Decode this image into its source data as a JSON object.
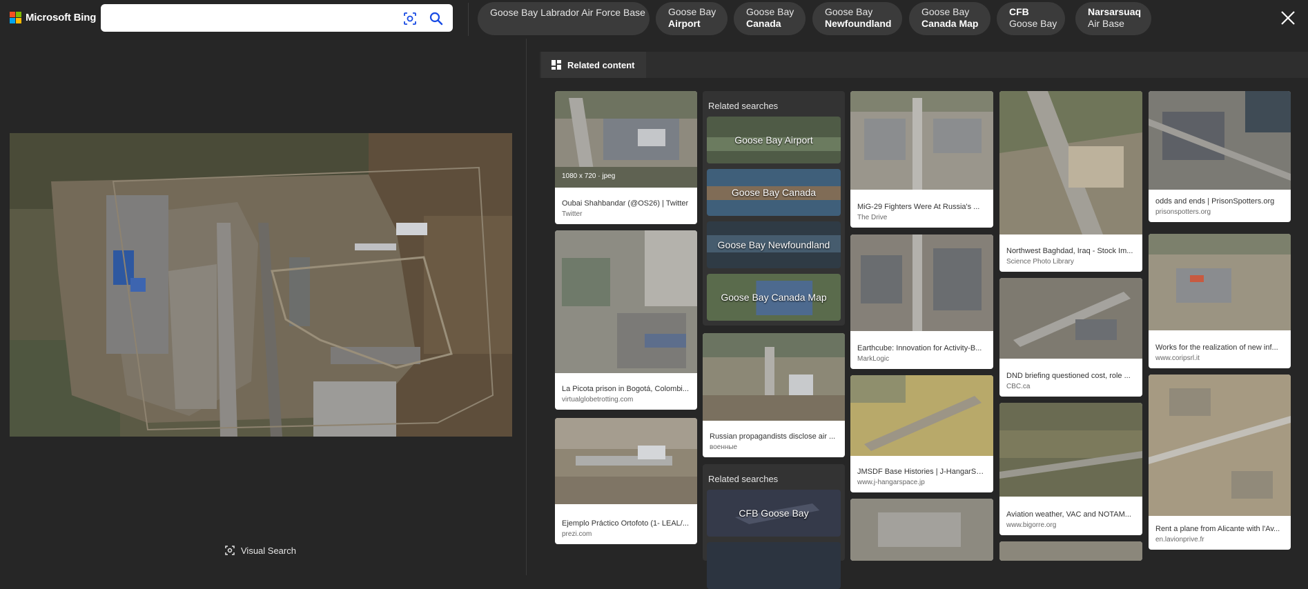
{
  "header": {
    "brand": "Microsoft Bing",
    "search_value": "",
    "search_placeholder": "",
    "chips": [
      {
        "line1": "Goose Bay Labrador Air Force Base",
        "line2": ""
      },
      {
        "line1": "Goose Bay",
        "line2": "Airport"
      },
      {
        "line1": "Goose Bay",
        "line2": "Canada"
      },
      {
        "line1": "Goose Bay",
        "line2": "Newfoundland"
      },
      {
        "line1": "Goose Bay",
        "line2": "Canada Map"
      },
      {
        "line1": "CFB",
        "line2": "Goose Bay"
      },
      {
        "line1": "Narsarsuaq",
        "line2": "Air Base"
      }
    ]
  },
  "viewer": {
    "visual_search_label": "Visual Search"
  },
  "related": {
    "tab_label": "Related content",
    "search_groups": [
      {
        "heading": "Related searches",
        "items": [
          "Goose Bay Airport",
          "Goose Bay Canada",
          "Goose Bay Newfoundland",
          "Goose Bay Canada Map"
        ]
      },
      {
        "heading": "Related searches",
        "items": [
          "CFB Goose Bay",
          ""
        ]
      }
    ],
    "cards": [
      {
        "title": "Oubai Shahbandar (@OS26) | Twitter",
        "source": "Twitter",
        "dims": "1080 x 720 · jpeg"
      },
      {
        "title": "La Picota prison in Bogotá, Colombi...",
        "source": "virtualglobetrotting.com",
        "dims": ""
      },
      {
        "title": "Ejemplo Práctico Ortofoto (1- LEAL/...",
        "source": "prezi.com",
        "dims": ""
      },
      {
        "title": "Russian propagandists disclose air ...",
        "source": "военные",
        "dims": ""
      },
      {
        "title": "MiG-29 Fighters Were At Russia's ...",
        "source": "The Drive",
        "dims": ""
      },
      {
        "title": "Earthcube: Innovation for Activity-B...",
        "source": "MarkLogic",
        "dims": ""
      },
      {
        "title": "JMSDF Base Histories | J-HangarSp...",
        "source": "www.j-hangarspace.jp",
        "dims": ""
      },
      {
        "title": "Northwest Baghdad, Iraq - Stock Im...",
        "source": "Science Photo Library",
        "dims": ""
      },
      {
        "title": "DND briefing questioned cost, role ...",
        "source": "CBC.ca",
        "dims": ""
      },
      {
        "title": "Aviation weather, VAC and NOTAM...",
        "source": "www.bigorre.org",
        "dims": ""
      },
      {
        "title": "odds and ends | PrisonSpotters.org",
        "source": "prisonspotters.org",
        "dims": ""
      },
      {
        "title": "Works for the realization of new inf...",
        "source": "www.coripsrl.it",
        "dims": ""
      },
      {
        "title": "Rent a plane from Alicante with l'Av...",
        "source": "en.lavionprive.fr",
        "dims": ""
      }
    ]
  },
  "colors": {
    "background": "#262626",
    "chip": "#3b3b3b",
    "accent_blue": "#174ae4"
  }
}
